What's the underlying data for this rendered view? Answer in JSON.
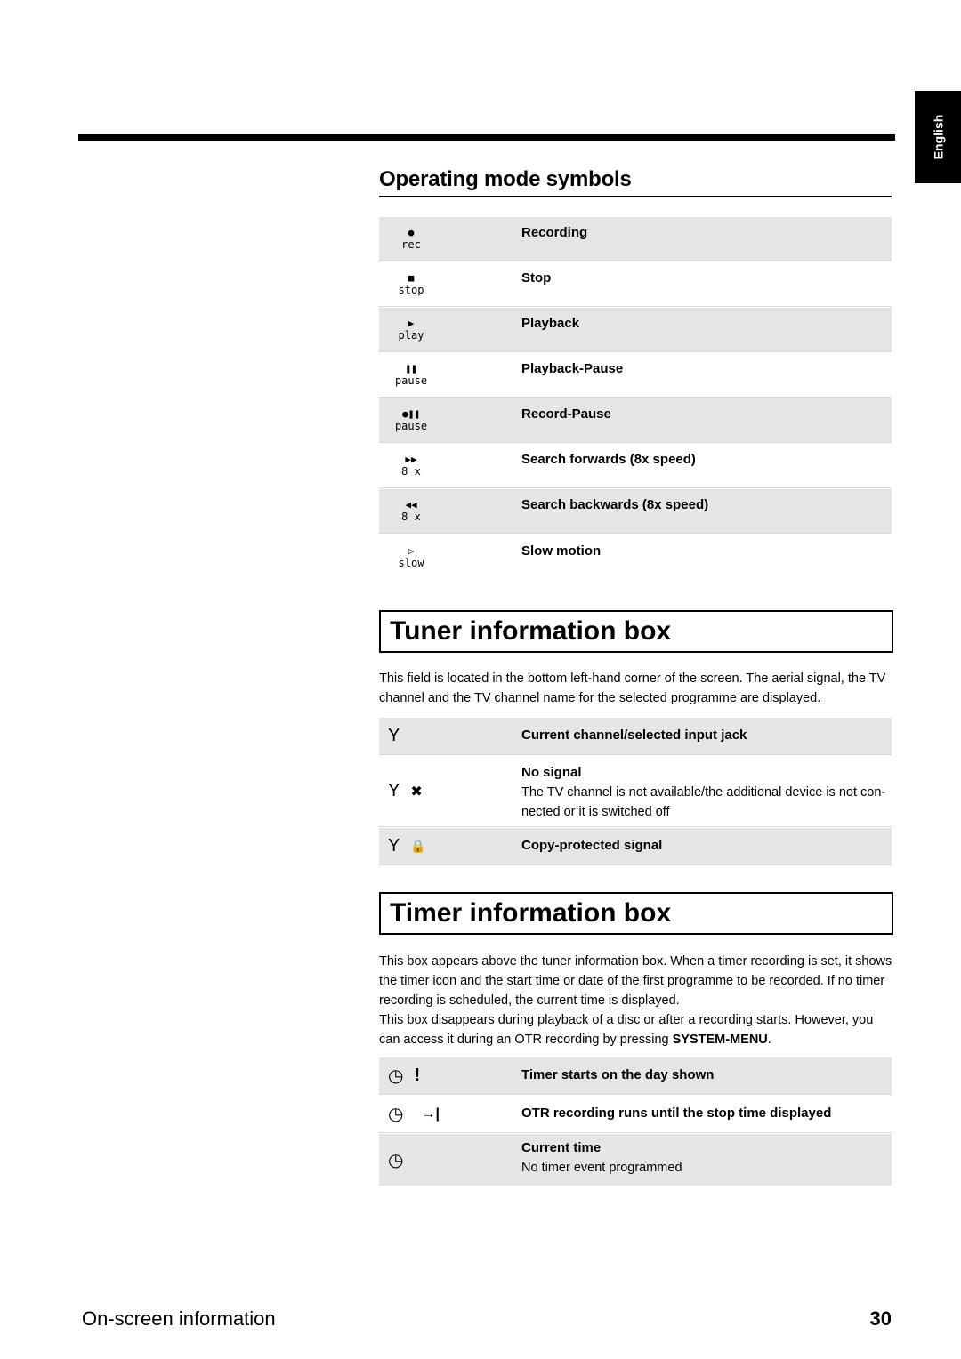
{
  "language_tab": "English",
  "operating_modes": {
    "title": "Operating mode symbols",
    "rows": [
      {
        "glyph": "●",
        "word": "rec",
        "label": "Recording",
        "icon": "record-icon"
      },
      {
        "glyph": "■",
        "word": "stop",
        "label": "Stop",
        "icon": "stop-icon"
      },
      {
        "glyph": "▶",
        "word": "play",
        "label": "Playback",
        "icon": "play-icon"
      },
      {
        "glyph": "❚❚",
        "word": "pause",
        "label": "Playback-Pause",
        "icon": "pause-icon"
      },
      {
        "glyph": "●❚❚",
        "word": "pause",
        "label": "Record-Pause",
        "icon": "record-pause-icon"
      },
      {
        "glyph": "▶▶",
        "word": "8 x",
        "label": "Search forwards (8x speed)",
        "icon": "fast-forward-icon"
      },
      {
        "glyph": "◀◀",
        "word": "8 x",
        "label": "Search backwards (8x speed)",
        "icon": "rewind-icon"
      },
      {
        "glyph": "▷",
        "word": "slow",
        "label": "Slow motion",
        "icon": "slow-motion-icon"
      }
    ]
  },
  "tuner": {
    "title": "Tuner information box",
    "description": "This field is located in the bottom left-hand corner of the screen. The aerial signal, the TV channel and the TV channel name for the selected programme are displayed.",
    "rows": [
      {
        "icons": [
          "Y"
        ],
        "title": "Current channel/selected input jack",
        "note": ""
      },
      {
        "icons": [
          "Y",
          "✖"
        ],
        "title": "No signal",
        "note": "The TV channel is not available/the additional device is not con-nected or it is switched off"
      },
      {
        "icons": [
          "Y",
          "🔒"
        ],
        "title": "Copy-protected signal",
        "note": ""
      }
    ]
  },
  "timer": {
    "title": "Timer information box",
    "description_1": "This box appears above the tuner information box. When a timer recording is set, it shows the timer icon and the start time or date of the first programme to be recorded. If no timer recording is scheduled, the current time is displayed.",
    "description_2_pre": "This box disappears during playback of a disc or after a recording starts. However, you can access it during an OTR recording by pressing ",
    "description_2_key": "SYSTEM-MENU",
    "description_2_post": ".",
    "rows": [
      {
        "icons": [
          "◷",
          "!"
        ],
        "title": "Timer starts on the day shown",
        "note": ""
      },
      {
        "icons": [
          "◷",
          "→|"
        ],
        "title": "OTR recording runs until the stop time displayed",
        "note": ""
      },
      {
        "icons": [
          "◷"
        ],
        "title": "Current time",
        "note": "No timer event programmed"
      }
    ]
  },
  "footer": {
    "section": "On-screen information",
    "page_number": "30"
  }
}
